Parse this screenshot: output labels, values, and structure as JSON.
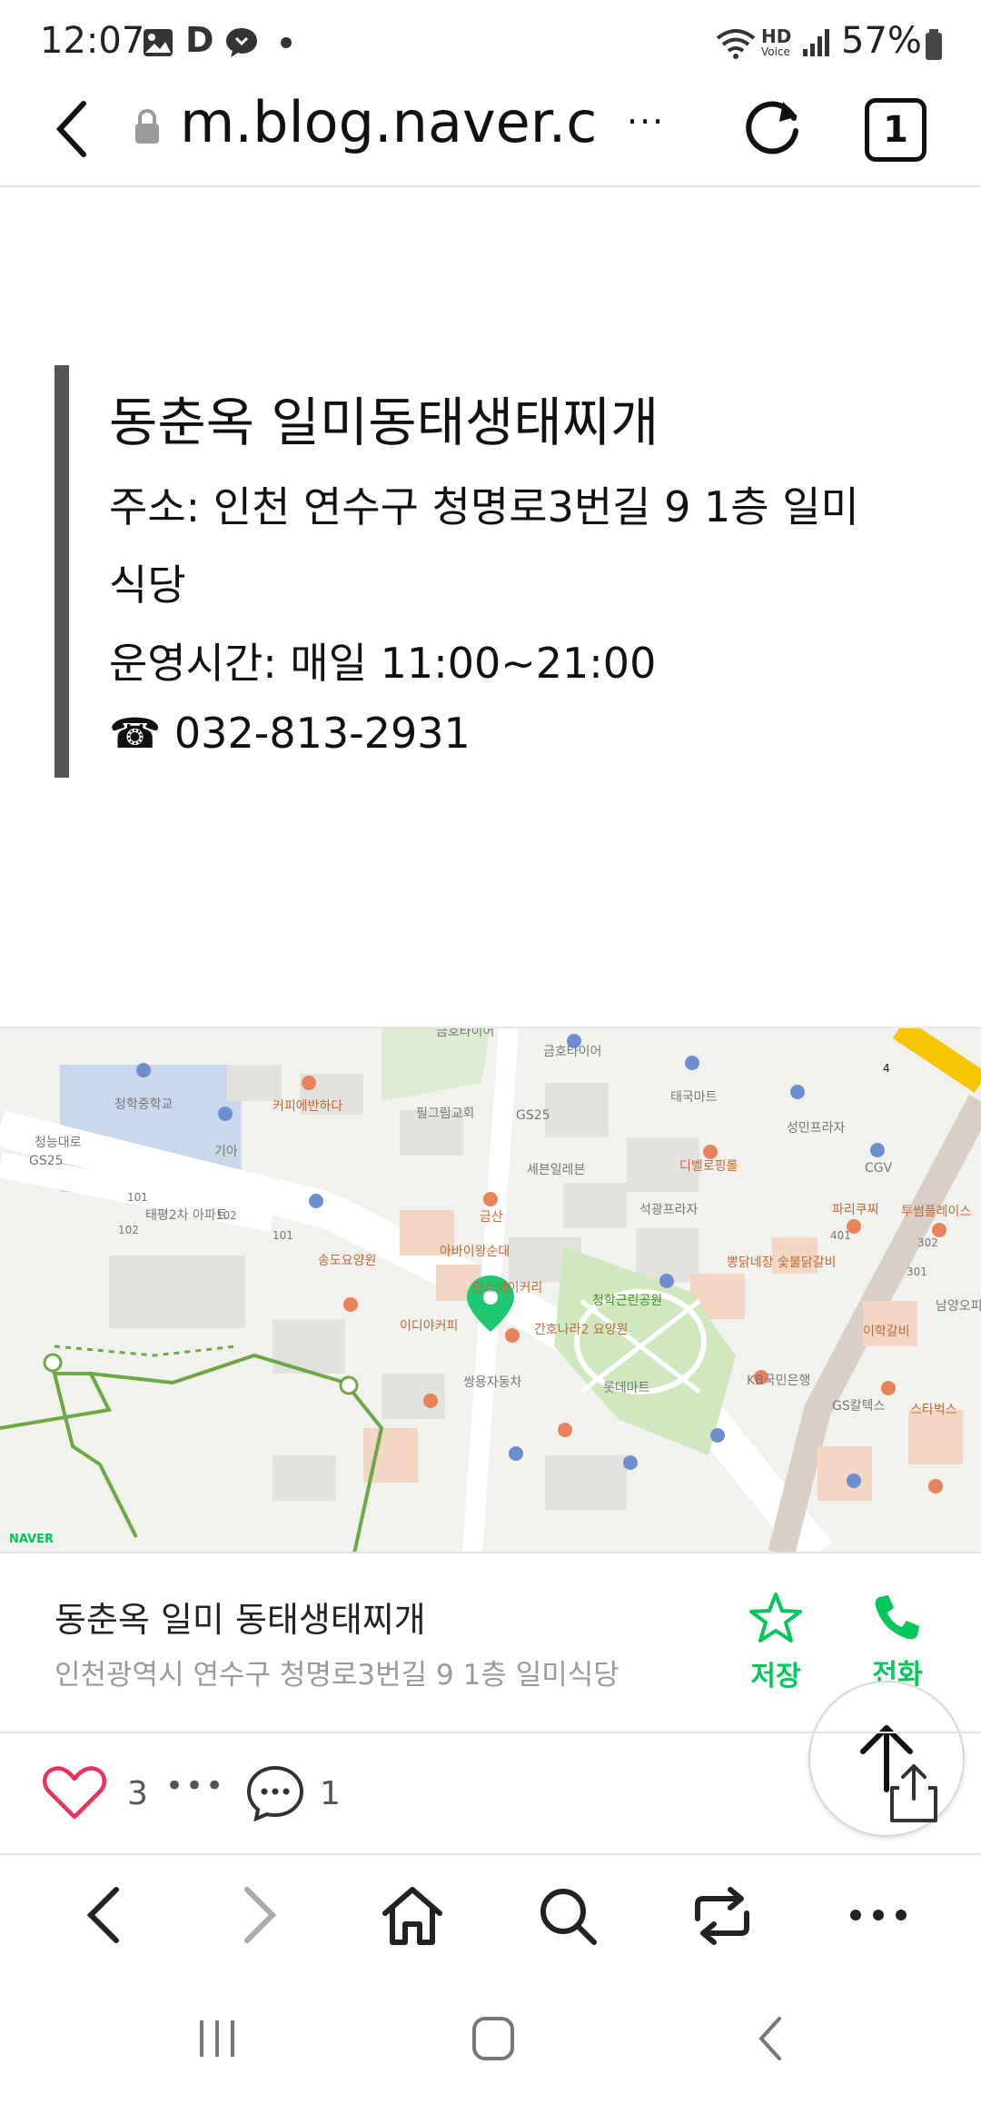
{
  "status_bar": {
    "time": "12:07",
    "battery": "57%",
    "notif_d": "D",
    "hd_label": "HD",
    "voice_label": "Voice"
  },
  "browser": {
    "url": "m.blog.naver.c",
    "more": "···",
    "tab_count": "1"
  },
  "info": {
    "title": "동춘옥 일미동태생태찌개",
    "address_line1": "주소: 인천 연수구 청명로3번길 9 1층 일미",
    "address_line2": "식당",
    "hours": "운영시간: 매일 11:00~21:00",
    "phone": "☎ 032-813-2931"
  },
  "map": {
    "labels": {
      "school": "청학중학교",
      "cafe1": "커피에반하다",
      "church": "필그림교회",
      "gs25a": "GS25",
      "kumho1": "금호타이어",
      "kumho2": "금호타이어",
      "taeguk": "태국마트",
      "seongmin": "성민프라자",
      "kia": "기아",
      "gs25b": "GS25",
      "geumsan": "금산",
      "seven": "세븐일레븐",
      "dibell": "디벨로핑롤",
      "cgv": "CGV",
      "taepyeong": "태평2차 아파트",
      "seokgwang": "석광프라자",
      "paris": "파리쿠찌",
      "twosome": "투썸플레이스",
      "songdo": "송도요양원",
      "abai": "아바이왕순대",
      "ansu": "안스베이커리",
      "park": "청학근린공원",
      "ttongdak": "뽕닭네장 숯불닭갈비",
      "ediya": "이디야커피",
      "ganho": "간호나라2 요양원",
      "ssangyong": "쌍용자동차",
      "lotte": "롯데마트",
      "kb": "KB국민은행",
      "gscaltex": "GS칼텍스",
      "starbucks": "스타벅스",
      "ihak": "이학갈비",
      "namyang": "남양오피",
      "cheongnung": "청능대로",
      "naver": "NAVER",
      "n101a": "101",
      "n102a": "102",
      "n102b": "102",
      "n101b": "101",
      "n401": "401",
      "n302": "302",
      "n301": "301",
      "line4": "4"
    }
  },
  "place_card": {
    "name": "동춘옥 일미 동태생태찌개",
    "address": "인천광역시 연수구 청명로3번길 9 1층 일미식당",
    "save_label": "저장",
    "call_label": "전화"
  },
  "reactions": {
    "likes": "3",
    "dots": "•••",
    "comments": "1"
  },
  "colors": {
    "naver_green": "#03c75a",
    "heart": "#e8345a"
  }
}
